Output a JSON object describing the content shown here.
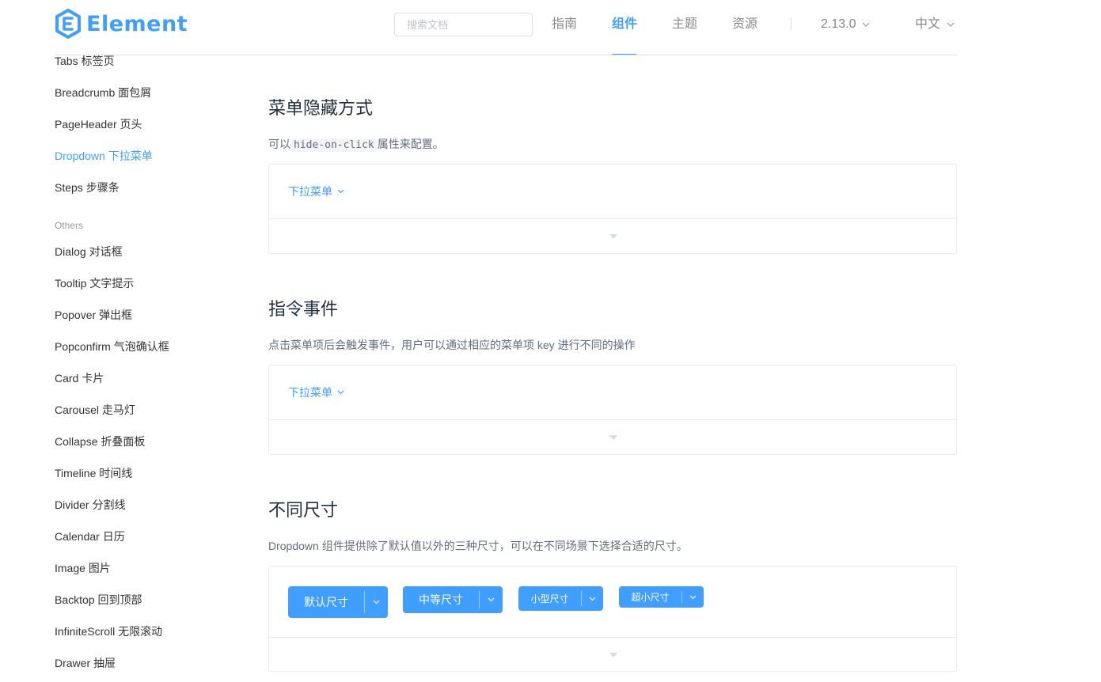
{
  "header": {
    "logo_text": "Element",
    "search_placeholder": "搜索文档",
    "nav": [
      "指南",
      "组件",
      "主题",
      "资源"
    ],
    "version": "2.13.0",
    "language": "中文",
    "accent_color": "#409eff"
  },
  "sidebar": {
    "items_top": [
      "Tabs 标签页",
      "Breadcrumb 面包屑",
      "PageHeader 页头",
      "Dropdown 下拉菜单",
      "Steps 步骤条"
    ],
    "group_label": "Others",
    "items_others": [
      "Dialog 对话框",
      "Tooltip 文字提示",
      "Popover 弹出框",
      "Popconfirm 气泡确认框",
      "Card 卡片",
      "Carousel 走马灯",
      "Collapse 折叠面板",
      "Timeline 时间线",
      "Divider 分割线",
      "Calendar 日历",
      "Image 图片",
      "Backtop 回到顶部",
      "InfiniteScroll 无限滚动",
      "Drawer 抽屉"
    ],
    "active_item": "Dropdown 下拉菜单"
  },
  "sections": [
    {
      "title": "菜单隐藏方式",
      "desc_prefix": "可以",
      "desc_code": "hide-on-click",
      "desc_suffix": "属性来配置。",
      "dropdown_label": "下拉菜单"
    },
    {
      "title": "指令事件",
      "desc": "点击菜单项后会触发事件，用户可以通过相应的菜单项 key 进行不同的操作",
      "dropdown_label": "下拉菜单"
    },
    {
      "title": "不同尺寸",
      "desc": "Dropdown 组件提供除了默认值以外的三种尺寸，可以在不同场景下选择合适的尺寸。",
      "buttons": [
        "默认尺寸",
        "中等尺寸",
        "小型尺寸",
        "超小尺寸"
      ]
    }
  ]
}
